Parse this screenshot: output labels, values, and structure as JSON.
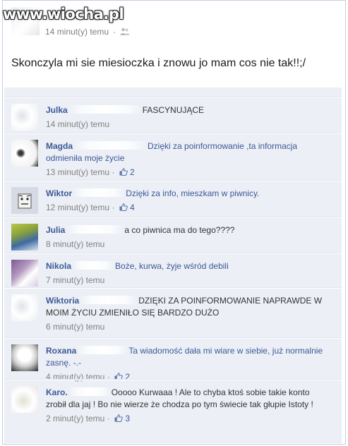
{
  "watermark": "www.wiocha.pl",
  "post": {
    "time": "14 minut(y) temu",
    "text": "Skonczyla mi sie miesioczka i znowu jo mam cos nie tak!!;/",
    "audience_icon": "people-icon"
  },
  "comments": [
    {
      "name": "Julka",
      "text": "FASCYNUJĄCE",
      "time": "14 minut(y) temu",
      "likes": "",
      "text_color": "dark",
      "avatar": "gray-blur"
    },
    {
      "name": "Magda",
      "text": "Dzięki za poinformowanie ,ta informacja odmieniła moje życie",
      "time": "13 minut(y) temu",
      "likes": "2",
      "text_color": "blue",
      "avatar": "white-blur"
    },
    {
      "name": "Wiktor",
      "text": "Dzięki za info, mieszkam w piwnicy.",
      "time": "12 minut(y) temu",
      "likes": "4",
      "text_color": "blue",
      "avatar": "face"
    },
    {
      "name": "Julia",
      "text": "a co piwnica ma do tego????",
      "time": "8 minut(y) temu",
      "likes": "",
      "text_color": "dark",
      "avatar": "green-blue"
    },
    {
      "name": "Nikola",
      "text": "Boże, kurwa, żyje wśród debili",
      "time": "7 minut(y) temu",
      "likes": "",
      "text_color": "blue",
      "avatar": "purple"
    },
    {
      "name": "Wiktoria",
      "text": "DZIĘKI ZA POINFORMOWANIE NAPRAWDE W MOIM ŻYCIU ZMIENIŁO SIĘ BARDZO DUŻO",
      "time": "6 minut(y) temu",
      "likes": "",
      "text_color": "dark",
      "avatar": "gray-blur"
    },
    {
      "name": "Roxana",
      "text": "Ta wiadomość dała mi wiare w siebie, już normalnie zasnę. -.-",
      "time": "4 minut(y) temu",
      "likes": "2",
      "text_color": "blue",
      "avatar": "dark-blur"
    },
    {
      "name": "Karo.",
      "text": "Ooooo Kurwaaa ! Ale to chyba ktoś sobie takie konto zrobił dla jaj ! Bo nie wierze że chodza po tym świecie tak głupie Istoty !",
      "time": "2 minut(y) temu",
      "likes": "3",
      "text_color": "dark",
      "avatar": "light-blur"
    }
  ],
  "colors": {
    "link": "#3b5998",
    "meta": "#808080",
    "comment_bg": "#eceff5"
  },
  "like_icon": "thumbs-up-icon"
}
